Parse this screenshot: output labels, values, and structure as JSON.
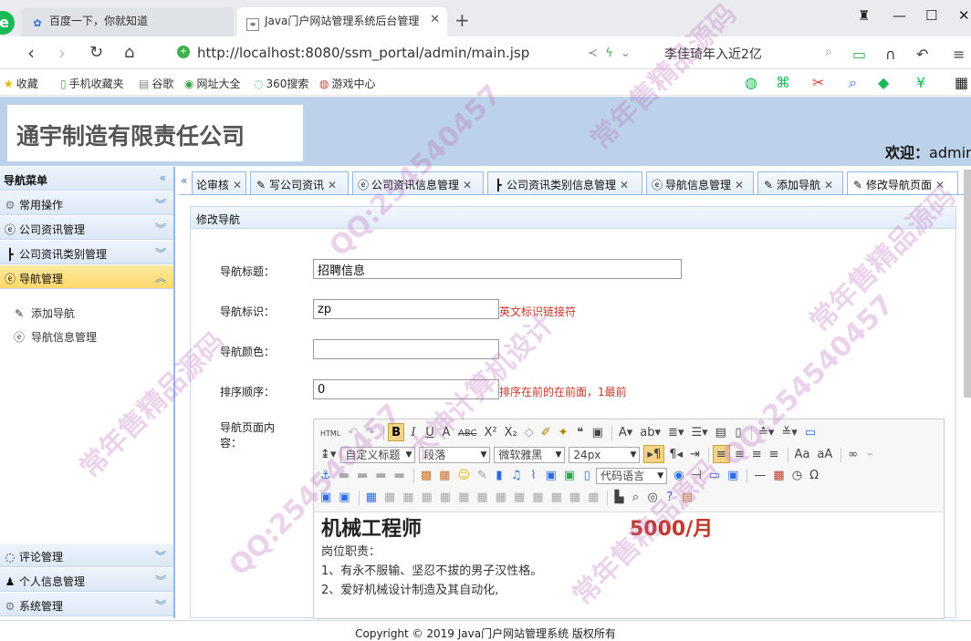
{
  "browser": {
    "tabs": [
      {
        "title": "百度一下，你就知道",
        "icon": "paw-icon"
      },
      {
        "title": "Java门户网站管理系统后台管理",
        "icon": "document-icon"
      }
    ],
    "address": "http://localhost:8080/ssm_portal/admin/main.jsp",
    "search": "李佳琦年入近2亿",
    "bookmarks": [
      "收藏",
      "手机收藏夹",
      "谷歌",
      "网址大全",
      "360搜索",
      "游戏中心"
    ]
  },
  "header": {
    "company": "通宇制造有限责任公司",
    "welcome_label": "欢迎：",
    "welcome_user": "admin"
  },
  "sidebar": {
    "title": "导航菜单",
    "groups": [
      {
        "label": "常用操作",
        "icon": "gear-icon"
      },
      {
        "label": "公司资讯管理",
        "icon": "circle-e-icon"
      },
      {
        "label": "公司资讯类别管理",
        "icon": "tree-icon"
      },
      {
        "label": "导航管理",
        "icon": "circle-e-icon"
      }
    ],
    "sub_items": [
      "添加导航",
      "导航信息管理"
    ],
    "bottom_groups": [
      "评论管理",
      "个人信息管理",
      "系统管理"
    ]
  },
  "tabs": [
    "论审核",
    "写公司资讯",
    "公司资讯信息管理",
    "公司资讯类别信息管理",
    "导航信息管理",
    "添加导航",
    "修改导航页面"
  ],
  "form": {
    "panel_title": "修改导航",
    "title_label": "导航标题：",
    "title_value": "招聘信息",
    "code_label": "导航标识：",
    "code_value": "zp",
    "code_hint": "英文标识链接符",
    "color_label": "导航颜色：",
    "color_value": "",
    "order_label": "排序顺序：",
    "order_value": "0",
    "order_hint": "排序在前的在前面，1最前",
    "content_label_1": "导航页面内",
    "content_label_2": "容："
  },
  "editor": {
    "heading_select": "自定义标题",
    "paragraph_select": "段落",
    "font_select": "微软雅黑",
    "size_select": "24px",
    "code_select": "代码语言",
    "job_title": "机械工程师",
    "salary": "5000/月",
    "lines": [
      "岗位职责：",
      "1、有永不服输、坚忍不拔的男子汉性格。",
      "2、爱好机械设计制造及其自动化,"
    ]
  },
  "footer": "Copyright © 2019 Java门户网站管理系统 版权所有",
  "watermark": [
    "常年售精品源码",
    "QQ:254540457",
    "大神计算机设计"
  ]
}
